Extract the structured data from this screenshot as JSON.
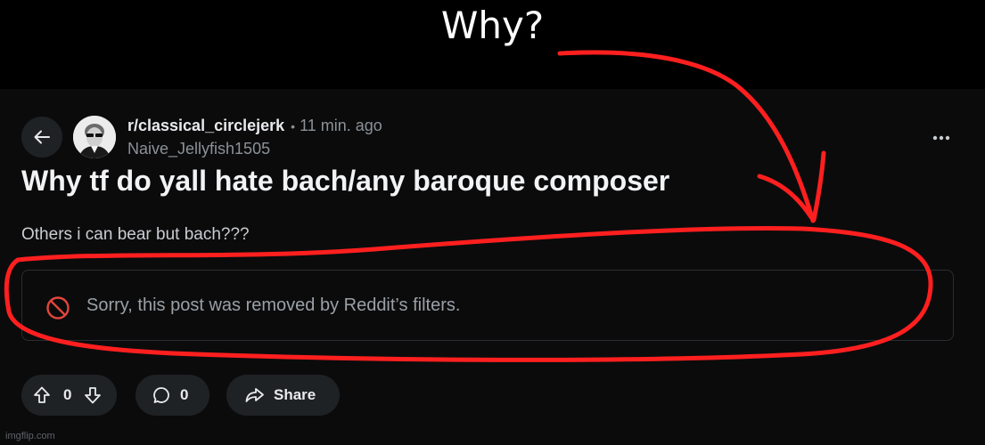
{
  "meme": {
    "caption": "Why?"
  },
  "post": {
    "subreddit": "r/classical_circlejerk",
    "separator": "•",
    "time": "11 min. ago",
    "author": "Naive_Jellyfish1505",
    "title": "Why tf do yall hate bach/any baroque composer",
    "body": "Others i can bear but bach???",
    "removed_notice": "Sorry, this post was removed by Reddit’s filters."
  },
  "actions": {
    "vote_count": "0",
    "comment_count": "0",
    "share_label": "Share"
  },
  "icons": {
    "back": "back-arrow-icon",
    "more": "more-options-icon",
    "removed": "ban-icon",
    "upvote": "upvote-icon",
    "downvote": "downvote-icon",
    "comment": "comment-icon",
    "share": "share-icon"
  },
  "colors": {
    "annotation": "#ff1f1f",
    "background": "#0b0b0c",
    "pill": "#1f2224",
    "muted_text": "#8b9196",
    "removed_icon": "#e0463b"
  },
  "watermark": "imgflip.com"
}
